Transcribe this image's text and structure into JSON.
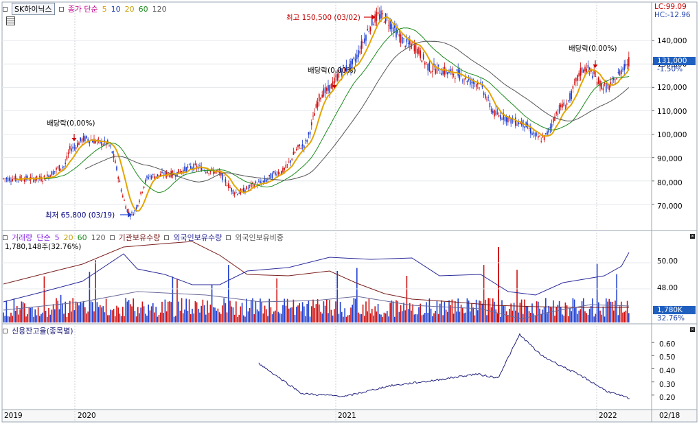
{
  "header": {
    "stock_name": "SK하이닉스",
    "ma_label": "종가 단순",
    "periods": [
      "5",
      "10",
      "20",
      "60",
      "120"
    ],
    "period_colors": [
      "#e09f00",
      "#1f3fa8",
      "#c8a000",
      "#1a8a1a",
      "#555555"
    ],
    "lc": "LC:99.09",
    "hc": "HC:-12.96",
    "calendar_icon": "grid-icon"
  },
  "volume_header": {
    "title": "거래량",
    "ma_label": "단순",
    "periods": [
      "5",
      "20",
      "60",
      "120"
    ],
    "period_colors": [
      "#8a2be2",
      "#c8a000",
      "#1a8a1a",
      "#555555"
    ],
    "series": [
      "기관보유수량",
      "외국인보유수량",
      "외국인보유비중"
    ],
    "series_colors": [
      "#7a1f1f",
      "#2a2a9a",
      "#555555"
    ],
    "readout": "1,780,148주(32.76%)"
  },
  "credit_header": {
    "title": "신용잔고율(종목별)"
  },
  "price_axis": {
    "ticks": [
      "140,000",
      "130,000",
      "120,000",
      "110,000",
      "100,000",
      "90,000",
      "80,000",
      "70,000"
    ],
    "tick_values": [
      140000,
      130000,
      120000,
      110000,
      100000,
      90000,
      80000,
      70000
    ],
    "current_price": "131,000",
    "current_change": "-1.50%"
  },
  "volume_axis": {
    "ticks": [
      "50.00",
      "48.00"
    ],
    "current_volume": "1,780K",
    "current_pct": "32.76%"
  },
  "credit_axis": {
    "ticks": [
      "0.60",
      "0.50",
      "0.40",
      "0.30",
      "0.20"
    ],
    "tick_values": [
      0.6,
      0.5,
      0.4,
      0.3,
      0.2
    ]
  },
  "x_axis": {
    "labels": [
      "2019",
      "2020",
      "2021",
      "2022",
      "02/18"
    ]
  },
  "annotations": {
    "high": "최고 150,500 (03/02)",
    "low": "최저 65,800 (03/19)",
    "dividend_1": "배당락(0.00%)",
    "dividend_2": "배당락(0.00%)",
    "dividend_3": "배당락(0.00%)"
  },
  "chart_data": {
    "type": "candlestick",
    "price_points": [
      {
        "date": "2019-11",
        "close": 81000
      },
      {
        "date": "2019-12",
        "close": 86000
      },
      {
        "date": "2019-12-27",
        "close": 94100
      },
      {
        "date": "2020-01",
        "close": 98000
      },
      {
        "date": "2020-02",
        "close": 96000
      },
      {
        "date": "2020-03-19",
        "close": 65800
      },
      {
        "date": "2020-04",
        "close": 82000
      },
      {
        "date": "2020-05",
        "close": 83000
      },
      {
        "date": "2020-06",
        "close": 86000
      },
      {
        "date": "2020-07",
        "close": 84000
      },
      {
        "date": "2020-08",
        "close": 75000
      },
      {
        "date": "2020-09",
        "close": 79000
      },
      {
        "date": "2020-10",
        "close": 84000
      },
      {
        "date": "2020-11",
        "close": 95000
      },
      {
        "date": "2020-12",
        "close": 118000
      },
      {
        "date": "2021-01",
        "close": 128000
      },
      {
        "date": "2021-03-02",
        "close": 150500
      },
      {
        "date": "2021-04",
        "close": 138000
      },
      {
        "date": "2021-05",
        "close": 128000
      },
      {
        "date": "2021-06",
        "close": 126000
      },
      {
        "date": "2021-07",
        "close": 122000
      },
      {
        "date": "2021-08",
        "close": 108000
      },
      {
        "date": "2021-09",
        "close": 105000
      },
      {
        "date": "2021-10",
        "close": 98000
      },
      {
        "date": "2021-11",
        "close": 112000
      },
      {
        "date": "2021-12",
        "close": 128000
      },
      {
        "date": "2022-01",
        "close": 120000
      },
      {
        "date": "2022-02-18",
        "close": 131000
      }
    ],
    "credit_ratio": [
      {
        "date": "2020-09",
        "value": 0.44
      },
      {
        "date": "2020-11",
        "value": 0.21
      },
      {
        "date": "2021-01",
        "value": 0.19
      },
      {
        "date": "2021-03",
        "value": 0.27
      },
      {
        "date": "2021-05",
        "value": 0.31
      },
      {
        "date": "2021-07",
        "value": 0.36
      },
      {
        "date": "2021-08",
        "value": 0.33
      },
      {
        "date": "2021-09",
        "value": 0.66
      },
      {
        "date": "2021-10",
        "value": 0.5
      },
      {
        "date": "2021-12",
        "value": 0.33
      },
      {
        "date": "2022-01",
        "value": 0.23
      },
      {
        "date": "2022-02-18",
        "value": 0.17
      }
    ],
    "high": {
      "date": "03/02",
      "value": 150500
    },
    "low": {
      "date": "03/19",
      "value": 65800
    },
    "ylim": [
      60000,
      155000
    ],
    "credit_ylim": [
      0.1,
      0.7
    ]
  }
}
